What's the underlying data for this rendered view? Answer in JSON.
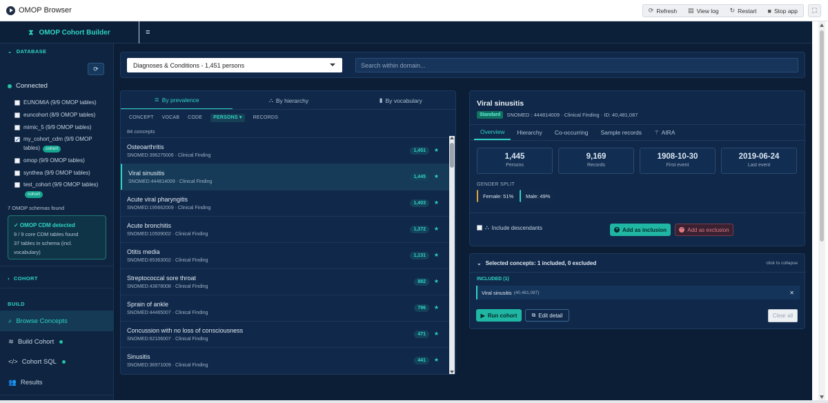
{
  "window": {
    "title": "OMOP Browser"
  },
  "header_buttons": {
    "refresh": "Refresh",
    "view_log": "View log",
    "restart": "Restart",
    "stop_app": "Stop app"
  },
  "brand": {
    "title": "OMOP Cohort Builder"
  },
  "sidebar": {
    "database_section": "DATABASE",
    "status": "Connected",
    "databases": [
      {
        "label": "EUNOMIA (9/9 OMOP tables)",
        "checked": false
      },
      {
        "label": "euncohort (8/9 OMOP tables)",
        "checked": false
      },
      {
        "label": "mimic_5 (9/9 OMOP tables)",
        "checked": false
      },
      {
        "label": "my_cohort_cdm (9/9 OMOP",
        "label2": "tables)",
        "checked": true,
        "tag": "cohort"
      },
      {
        "label": "omop (9/9 OMOP tables)",
        "checked": false
      },
      {
        "label": "synthea (9/9 OMOP tables)",
        "checked": false
      },
      {
        "label": "test_cohort (9/9 OMOP tables)",
        "checked": false,
        "tag": "cohort"
      }
    ],
    "schemas_found": "7 OMOP schemas found",
    "detected": {
      "title": "✓ OMOP CDM detected",
      "line1": "9 / 9 core CDM tables found",
      "line2": "37 tables in schema (incl.",
      "line3": "vocabulary)"
    },
    "cohort_section": "COHORT",
    "build_section": "BUILD",
    "nav": [
      {
        "label": "Browse Concepts",
        "active": true
      },
      {
        "label": "Build Cohort",
        "dot": true
      },
      {
        "label": "Cohort SQL",
        "dot": true
      },
      {
        "label": "Results"
      }
    ]
  },
  "domain_select": {
    "value": "Diagnoses & Conditions - 1,451 persons"
  },
  "search": {
    "placeholder": "Search within domain..."
  },
  "list_panel": {
    "tabs": [
      "By prevalence",
      "By hierarchy",
      "By vocabulary"
    ],
    "columns": [
      "CONCEPT",
      "VOCAB",
      "CODE",
      "PERSONS ▾",
      "RECORDS"
    ],
    "count": "84 concepts",
    "rows": [
      {
        "name": "Osteoarthritis",
        "code": "SNOMED:396275006 · Clinical Finding",
        "persons": "1,451"
      },
      {
        "name": "Viral sinusitis",
        "code": "SNOMED:444814009 · Clinical Finding",
        "persons": "1,445"
      },
      {
        "name": "Acute viral pharyngitis",
        "code": "SNOMED:195662009 · Clinical Finding",
        "persons": "1,403"
      },
      {
        "name": "Acute bronchitis",
        "code": "SNOMED:10509002 · Clinical Finding",
        "persons": "1,372"
      },
      {
        "name": "Otitis media",
        "code": "SNOMED:65363002 · Clinical Finding",
        "persons": "1,131"
      },
      {
        "name": "Streptococcal sore throat",
        "code": "SNOMED:43878008 · Clinical Finding",
        "persons": "882"
      },
      {
        "name": "Sprain of ankle",
        "code": "SNOMED:44465007 · Clinical Finding",
        "persons": "796"
      },
      {
        "name": "Concussion with no loss of consciousness",
        "code": "SNOMED:62106007 · Clinical Finding",
        "persons": "471"
      },
      {
        "name": "Sinusitis",
        "code": "SNOMED:36971009 · Clinical Finding",
        "persons": "441"
      }
    ]
  },
  "detail": {
    "title": "Viral sinusitis",
    "badge": "Standard",
    "meta": "SNOMED : 444814009 · Clinical Finding · ID: 40,481,087",
    "tabs": [
      "Overview",
      "Hierarchy",
      "Co-occurring",
      "Sample records",
      "AIRA"
    ],
    "stats": [
      {
        "value": "1,445",
        "label": "Persons"
      },
      {
        "value": "9,169",
        "label": "Records"
      },
      {
        "value": "1908-10-30",
        "label": "First event"
      },
      {
        "value": "2019-06-24",
        "label": "Last event"
      }
    ],
    "gender_label": "GENDER SPLIT",
    "female": "Female: 51%",
    "male": "Male: 49%",
    "include_desc": "Include descendants",
    "add_inclusion": "Add as inclusion",
    "add_exclusion": "Add as exclusion"
  },
  "selected": {
    "header": "Selected concepts: 1 included, 0 excluded",
    "collapse": "click to collapse",
    "included_label": "INCLUDED (1)",
    "chip_name": "Viral sinusitis",
    "chip_id": "(40,481,087)",
    "run": "Run cohort",
    "edit": "Edit detail",
    "clear": "Clear all"
  },
  "colors": {
    "accent": "#2fd3c4",
    "background": "#0b1e36",
    "panel": "#10294a"
  }
}
